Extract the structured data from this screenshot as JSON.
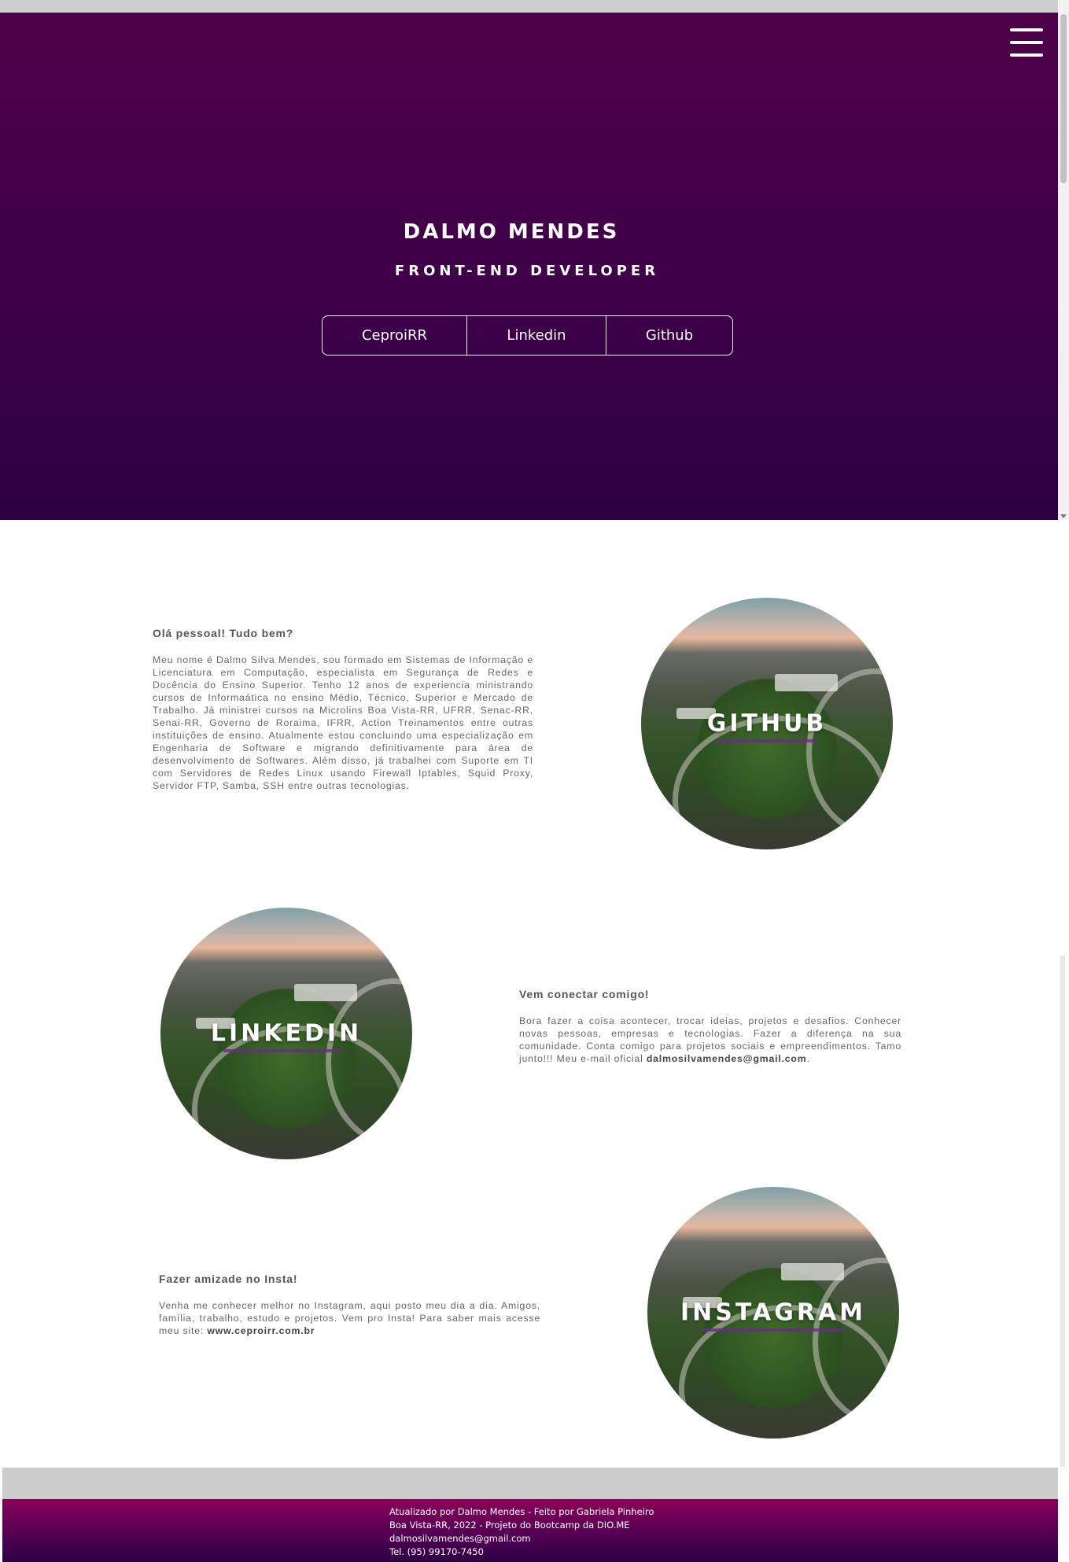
{
  "header": {
    "name": "DALMO MENDES",
    "role": "FRONT-END DEVELOPER",
    "links": [
      "CeproiRR",
      "Linkedin",
      "Github"
    ]
  },
  "sections": [
    {
      "title": "Olá pessoal! Tudo bem?",
      "text": "Meu nome é Dalmo Silva Mendes, sou formado em Sistemas de Informação e Licenciatura em Computação, especialista em Segurança de Redes e Docência do Ensino Superior. Tenho 12 anos de experiencia ministrando cursos de Informaática no ensino Médio, Técnico, Superior e Mercado de Trabalho. Já ministrei cursos na Microlins Boa Vista-RR, UFRR, Senac-RR, Senai-RR, Governo de Roraima, IFRR, Action Treinamentos entre outras instituições de ensino. Atualmente estou concluindo uma especialização em Engenharia de Software e migrando definitivamente para área de desenvolvimento de Softwares. Além disso, já trabalhei com Suporte em TI com Servidores de Redes Linux usando Firewall Iptables, Squid Proxy, Servidor FTP, Samba, SSH entre outras tecnologias.",
      "image_label": "GITHUB"
    },
    {
      "title": "Vem conectar comigo!",
      "text_before": "Bora fazer a coisa acontecer, trocar ideias, projetos e desafios. Conhecer novas pessoas, empresas e tecnologias. Fazer a diferença na sua comunidade. Conta comigo para projetos sociais e empreendimentos. Tamo junto!!! Meu e-mail oficial ",
      "text_bold": "dalmosilvamendes@gmail.com",
      "text_after": ".",
      "image_label": "LINKEDIN"
    },
    {
      "title": "Fazer amizade no Insta!",
      "text_before": "Venha me conhecer melhor no Instagram, aqui posto meu dia a dia. Amigos, família, trabalho, estudo e projetos. Vem pro Insta! Para saber mais acesse meu site: ",
      "text_bold": "www.ceproirr.com.br",
      "image_label": "INSTAGRAM"
    }
  ],
  "footer": {
    "lines": [
      "Atualizado por Dalmo Mendes - Feito por Gabriela Pinheiro",
      "Boa Vista-RR, 2022 - Projeto do Bootcamp da DIO.ME",
      "dalmosilvamendes@gmail.com",
      "Tel. (95) 99170-7450"
    ]
  },
  "icons": {
    "menu": "hamburger-menu-icon"
  },
  "colors": {
    "hero": "#4e0047",
    "footer_top": "#8a0058",
    "footer_bottom": "#2d0045"
  }
}
